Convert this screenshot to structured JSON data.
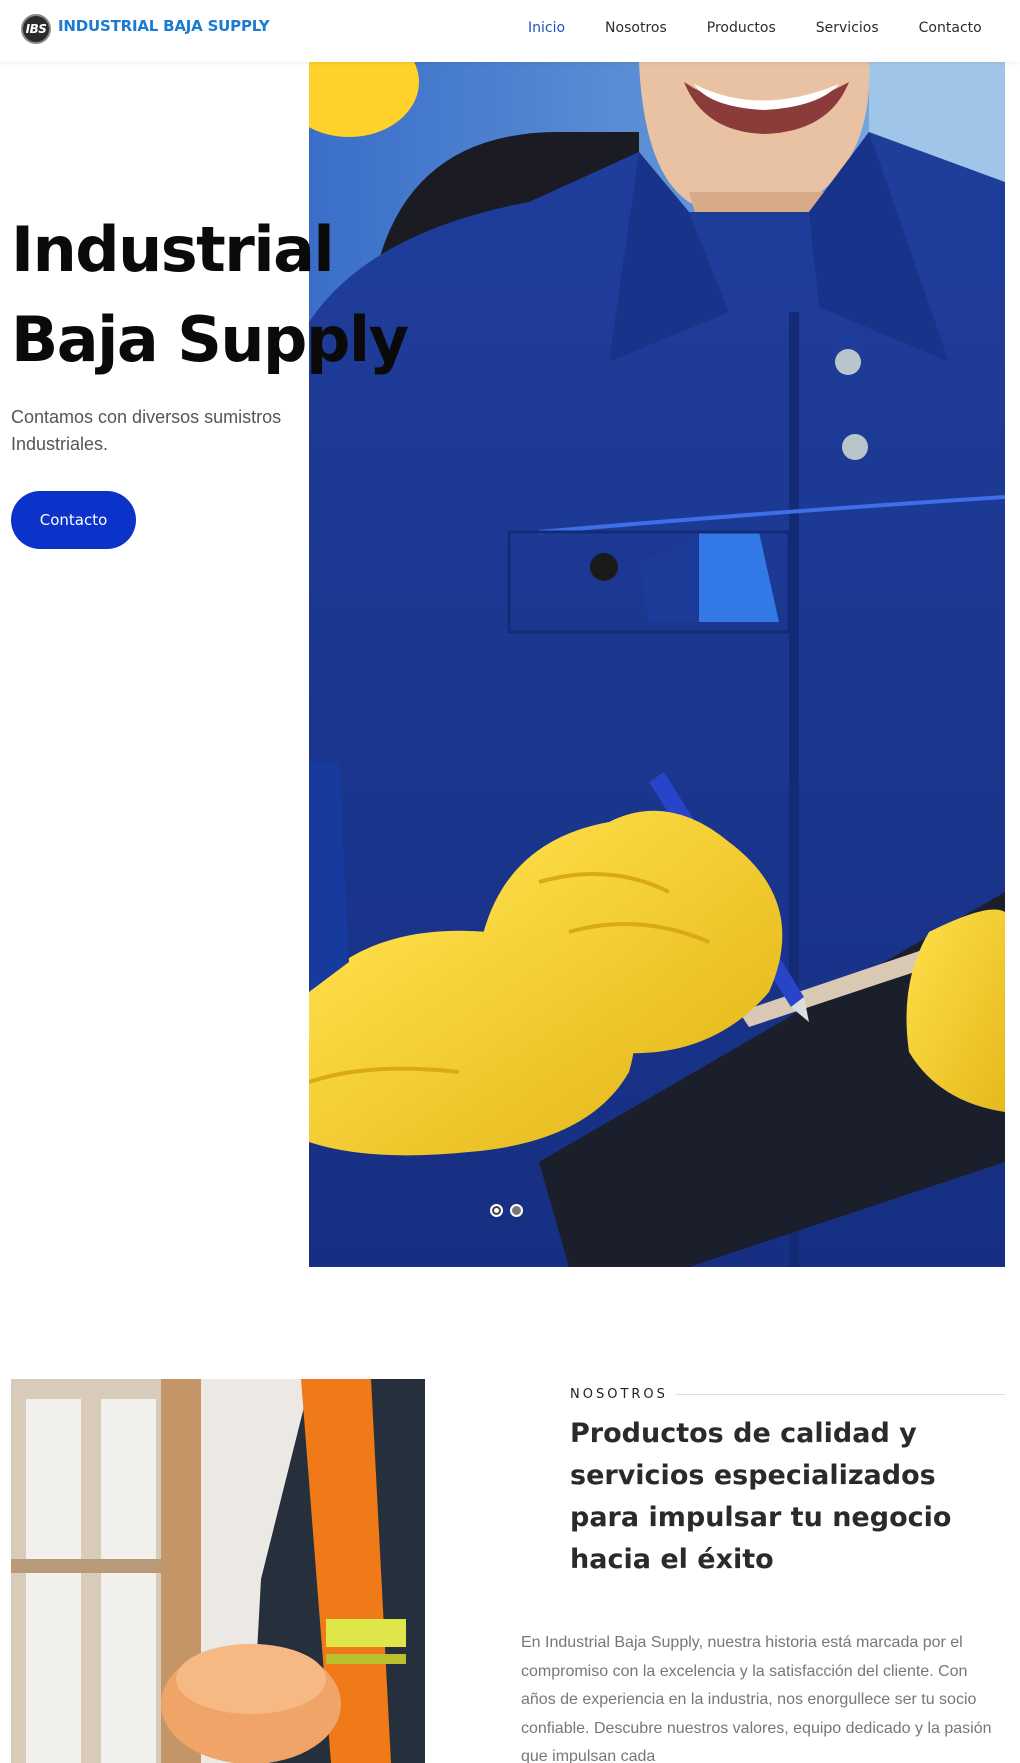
{
  "header": {
    "logo_badge": "IBS",
    "logo_text": "INDUSTRIAL BAJA SUPPLY",
    "nav": [
      {
        "label": "Inicio",
        "active": true
      },
      {
        "label": "Nosotros"
      },
      {
        "label": "Productos"
      },
      {
        "label": "Servicios"
      },
      {
        "label": "Contacto"
      }
    ]
  },
  "hero": {
    "title_line1": "Industrial",
    "title_line2": "Baja Supply",
    "subtitle": "Contamos con diversos sumistros Industriales.",
    "button_label": "Contacto",
    "slider": {
      "slides": 2,
      "active": 1
    }
  },
  "about": {
    "kicker": "NOSOTROS",
    "title": "Productos de calidad y servicios especializados para impulsar tu negocio hacia el éxito",
    "text": "En Industrial Baja Supply, nuestra historia está marcada por el compromiso con la excelencia y la satisfacción del cliente. Con años de experiencia en la industria, nos enorgullece ser tu socio confiable. Descubre nuestros valores, equipo dedicado y la pasión que impulsan cada"
  },
  "colors": {
    "brand_blue": "#1a7bd0",
    "button_blue": "#0b33c9",
    "nav_active": "#1f4fc4"
  }
}
